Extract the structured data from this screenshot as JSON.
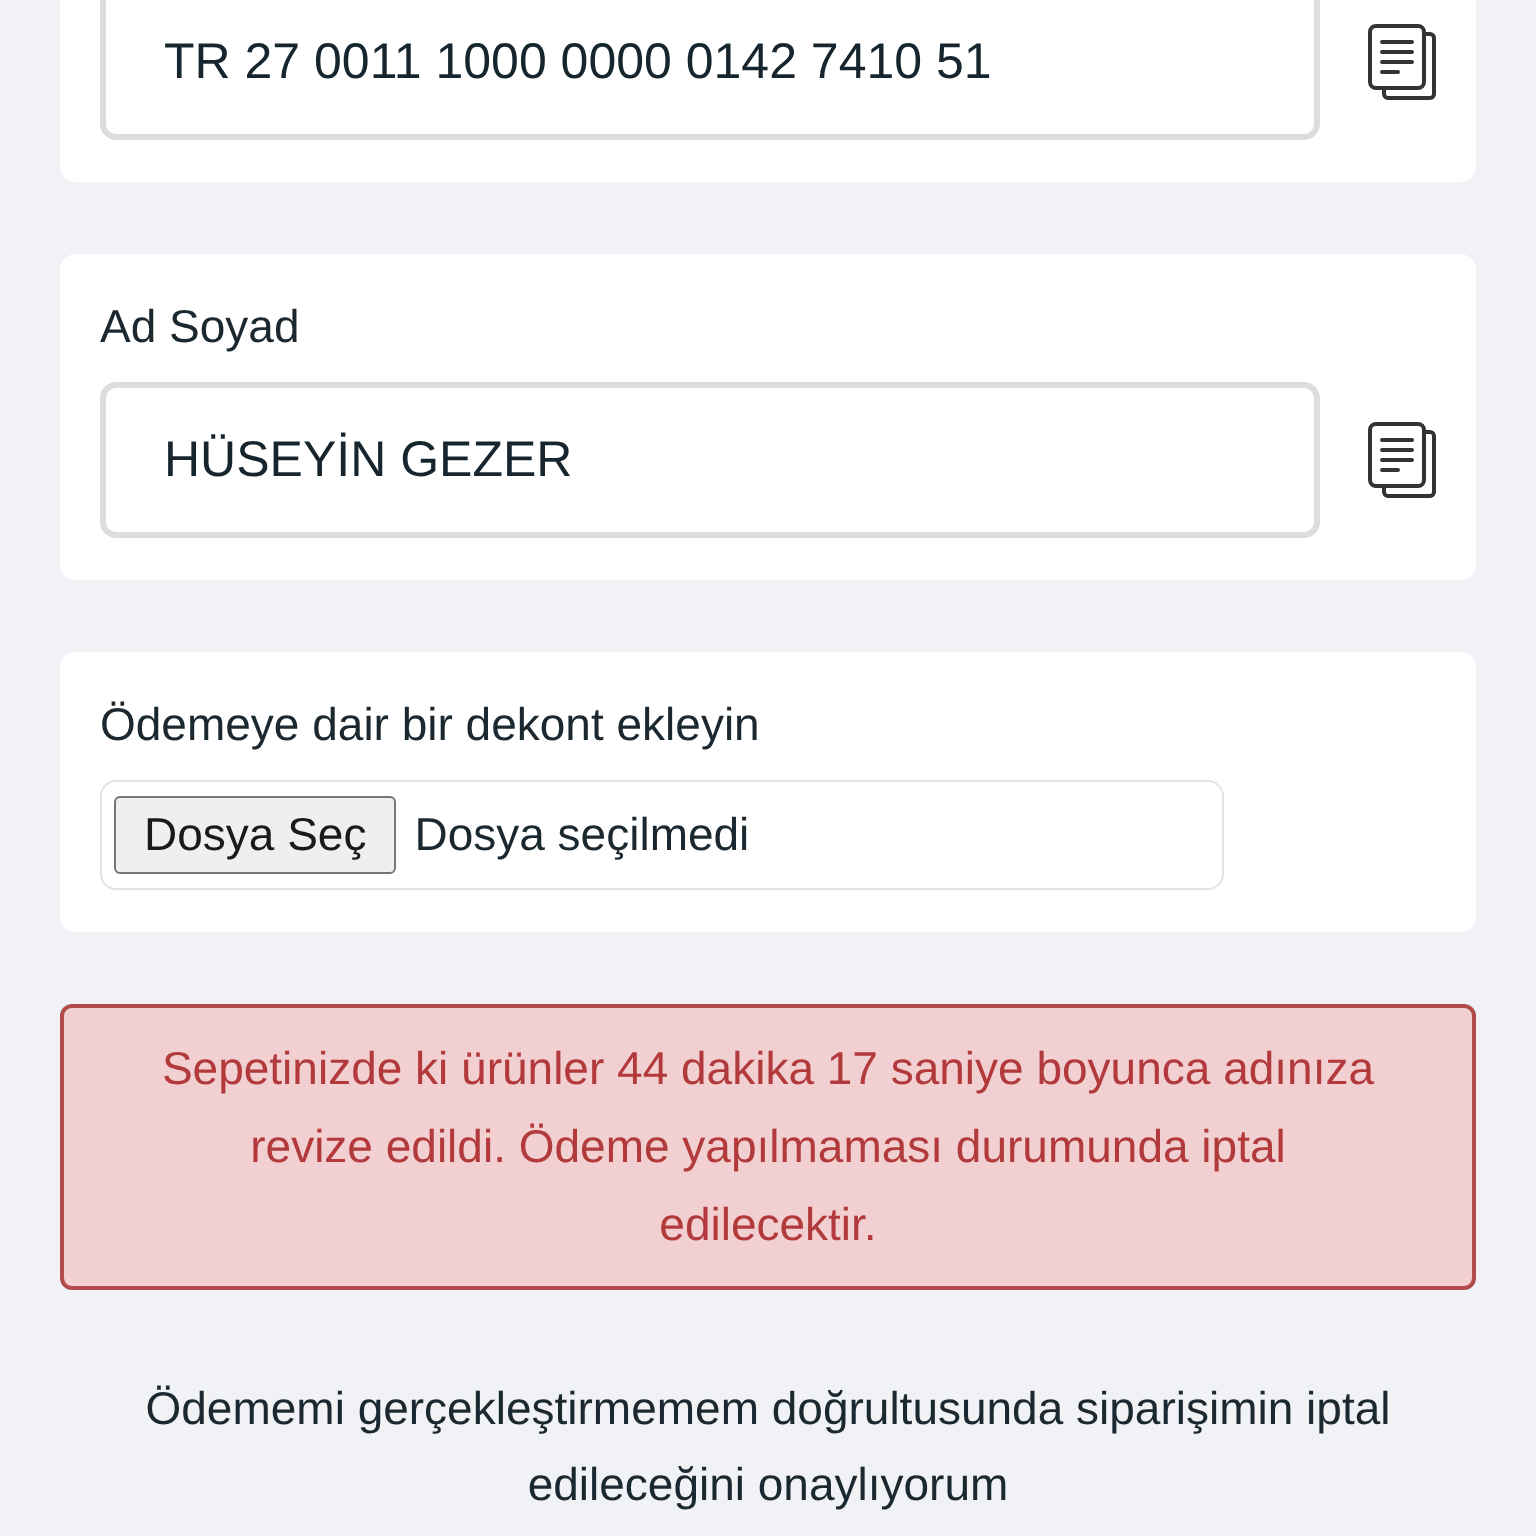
{
  "cards": [
    {
      "kind": "copy_field",
      "value": "TR 27 0011 1000 0000 0142 7410 51"
    },
    {
      "kind": "copy_field",
      "label": "Ad Soyad",
      "value": "HÜSEYİN GEZER"
    },
    {
      "kind": "file_upload",
      "label": "Ödemeye dair bir dekont ekleyin",
      "button": "Dosya Seç",
      "file_status": "Dosya seçilmedi"
    }
  ],
  "alert": {
    "text": "Sepetinizde ki ürünler 44 dakika 17 saniye boyunca adınıza revize edildi. Ödeme yapılmaması durumunda iptal edilecektir."
  },
  "consent": {
    "text": "Ödememi gerçekleştirmemem doğrultusunda siparişimin iptal edileceğini onaylıyorum"
  }
}
